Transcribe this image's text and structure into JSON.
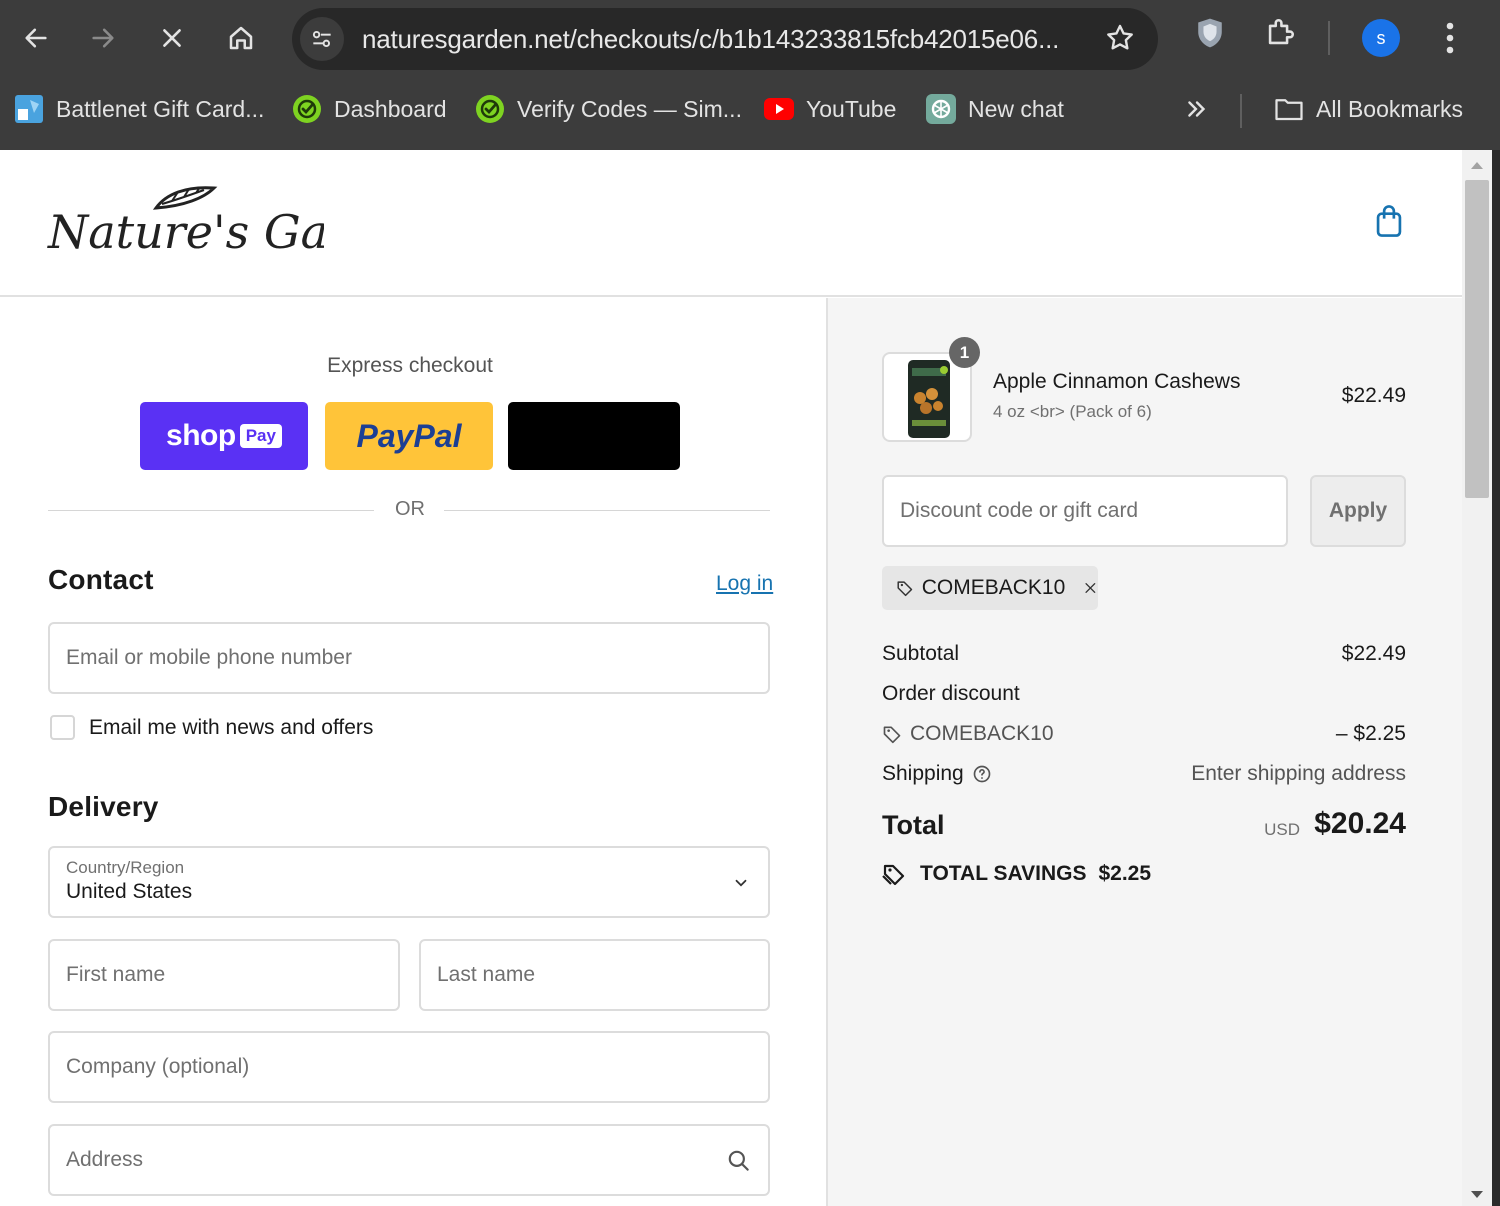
{
  "browser": {
    "url": "naturesgarden.net/checkouts/c/b1b143233815fcb42015e06...",
    "avatar_letter": "s",
    "bookmarks": [
      {
        "label": "Battlenet Gift Card...",
        "icon": "battlenet-icon"
      },
      {
        "label": "Dashboard",
        "icon": "green-check-icon"
      },
      {
        "label": "Verify Codes — Sim...",
        "icon": "green-check-icon"
      },
      {
        "label": "YouTube",
        "icon": "youtube-icon"
      },
      {
        "label": "New chat",
        "icon": "chatgpt-icon"
      }
    ],
    "all_bookmarks_label": "All Bookmarks"
  },
  "brand": {
    "name": "Nature's Garden"
  },
  "express": {
    "title": "Express checkout",
    "shop_label": "shop",
    "shop_pay_label": "Pay",
    "paypal_label": "PayPal",
    "or_label": "OR"
  },
  "contact": {
    "heading": "Contact",
    "login_label": "Log in",
    "email_placeholder": "Email or mobile phone number",
    "newsletter_label": "Email me with news and offers"
  },
  "delivery": {
    "heading": "Delivery",
    "country_label": "Country/Region",
    "country_value": "United States",
    "first_name_placeholder": "First name",
    "last_name_placeholder": "Last name",
    "company_placeholder": "Company (optional)",
    "address_placeholder": "Address"
  },
  "summary": {
    "item": {
      "quantity": "1",
      "name": "Apple Cinnamon Cashews",
      "variant": "4 oz <br> (Pack of 6)",
      "price": "$22.49"
    },
    "discount_placeholder": "Discount code or gift card",
    "apply_label": "Apply",
    "applied_code": "COMEBACK10",
    "subtotal_label": "Subtotal",
    "subtotal_value": "$22.49",
    "order_discount_label": "Order discount",
    "discount_code": "COMEBACK10",
    "discount_value": "– $2.25",
    "shipping_label": "Shipping",
    "shipping_value": "Enter shipping address",
    "total_label": "Total",
    "currency": "USD",
    "total_value": "$20.24",
    "savings_label": "TOTAL SAVINGS",
    "savings_value": "$2.25"
  },
  "colors": {
    "shop_pay": "#5a31f4",
    "paypal": "#ffc439",
    "link": "#1773b0",
    "chrome_bg": "#3c3c3c"
  }
}
